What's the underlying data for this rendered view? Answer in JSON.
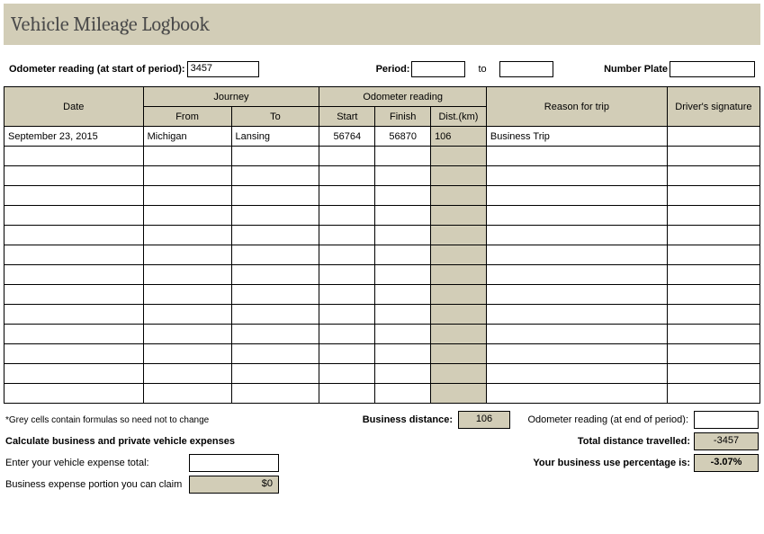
{
  "title": "Vehicle Mileage Logbook",
  "topFields": {
    "odoStartLabel": "Odometer reading (at start of period):",
    "odoStartValue": "3457",
    "periodLabel": "Period:",
    "periodFrom": "",
    "toLabel": "to",
    "periodTo": "",
    "plateLabel": "Number Plate",
    "plateValue": ""
  },
  "headers": {
    "date": "Date",
    "journey": "Journey",
    "from": "From",
    "to": "To",
    "odoReading": "Odometer reading",
    "start": "Start",
    "finish": "Finish",
    "dist": "Dist.(km)",
    "reason": "Reason for trip",
    "signature": "Driver's signature"
  },
  "rows": [
    {
      "date": "September 23, 2015",
      "from": "Michigan",
      "to": "Lansing",
      "start": "56764",
      "finish": "56870",
      "dist": "106",
      "reason": "Business Trip",
      "sig": ""
    },
    {
      "date": "",
      "from": "",
      "to": "",
      "start": "",
      "finish": "",
      "dist": "",
      "reason": "",
      "sig": ""
    },
    {
      "date": "",
      "from": "",
      "to": "",
      "start": "",
      "finish": "",
      "dist": "",
      "reason": "",
      "sig": ""
    },
    {
      "date": "",
      "from": "",
      "to": "",
      "start": "",
      "finish": "",
      "dist": "",
      "reason": "",
      "sig": ""
    },
    {
      "date": "",
      "from": "",
      "to": "",
      "start": "",
      "finish": "",
      "dist": "",
      "reason": "",
      "sig": ""
    },
    {
      "date": "",
      "from": "",
      "to": "",
      "start": "",
      "finish": "",
      "dist": "",
      "reason": "",
      "sig": ""
    },
    {
      "date": "",
      "from": "",
      "to": "",
      "start": "",
      "finish": "",
      "dist": "",
      "reason": "",
      "sig": ""
    },
    {
      "date": "",
      "from": "",
      "to": "",
      "start": "",
      "finish": "",
      "dist": "",
      "reason": "",
      "sig": ""
    },
    {
      "date": "",
      "from": "",
      "to": "",
      "start": "",
      "finish": "",
      "dist": "",
      "reason": "",
      "sig": ""
    },
    {
      "date": "",
      "from": "",
      "to": "",
      "start": "",
      "finish": "",
      "dist": "",
      "reason": "",
      "sig": ""
    },
    {
      "date": "",
      "from": "",
      "to": "",
      "start": "",
      "finish": "",
      "dist": "",
      "reason": "",
      "sig": ""
    },
    {
      "date": "",
      "from": "",
      "to": "",
      "start": "",
      "finish": "",
      "dist": "",
      "reason": "",
      "sig": ""
    },
    {
      "date": "",
      "from": "",
      "to": "",
      "start": "",
      "finish": "",
      "dist": "",
      "reason": "",
      "sig": ""
    },
    {
      "date": "",
      "from": "",
      "to": "",
      "start": "",
      "finish": "",
      "dist": "",
      "reason": "",
      "sig": ""
    }
  ],
  "footer": {
    "greyNote": "*Grey cells contain formulas so need not to change",
    "bizDistanceLabel": "Business distance:",
    "bizDistanceValue": "106",
    "odoEndLabel": "Odometer reading (at end of period):",
    "odoEndValue": "",
    "calcHeading": "Calculate business and private vehicle expenses",
    "totalDistLabel": "Total distance travelled:",
    "totalDistValue": "-3457",
    "expenseTotalLabel": "Enter your vehicle expense total:",
    "expenseTotalValue": "",
    "pctLabel": "Your business use percentage is:",
    "pctValue": "-3.07%",
    "claimLabel": "Business expense portion you can claim",
    "claimValue": "$0"
  }
}
